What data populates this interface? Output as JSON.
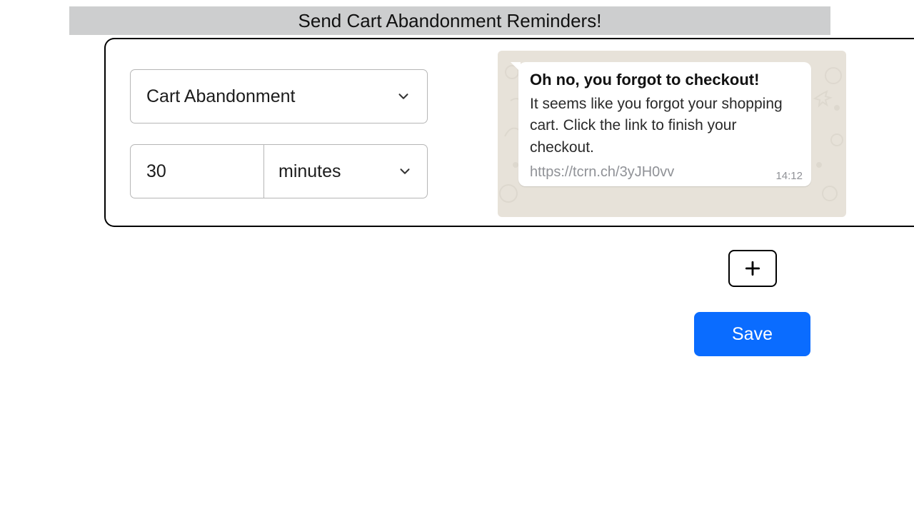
{
  "title": "Send Cart Abandonment Reminders!",
  "settings": {
    "type_selected": "Cart Abandonment",
    "delay_value": "30",
    "delay_unit": "minutes"
  },
  "preview": {
    "headline": "Oh no, you forgot to checkout!",
    "body": "It seems like you forgot your shopping cart. Click the link to finish your checkout.",
    "link": "https://tcrn.ch/3yJH0vv",
    "timestamp": "14:12"
  },
  "buttons": {
    "add_label": "+",
    "save_label": "Save"
  },
  "icons": {
    "chevron": "chevron-down-icon",
    "plus": "plus-icon"
  }
}
